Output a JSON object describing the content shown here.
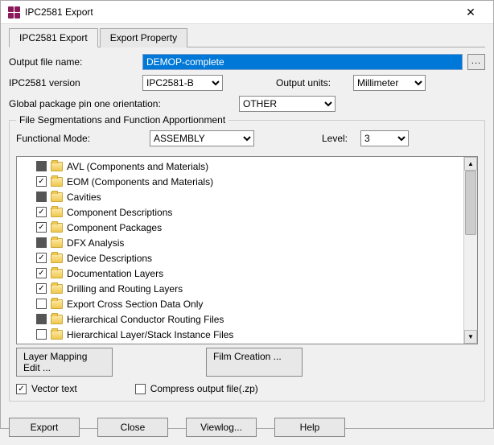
{
  "window": {
    "title": "IPC2581 Export"
  },
  "tabs": {
    "export": "IPC2581 Export",
    "property": "Export Property"
  },
  "fields": {
    "output_file_label": "Output file name:",
    "output_file_value": "DEMOP-complete",
    "version_label": "IPC2581 version",
    "version_value": "IPC2581-B",
    "output_units_label": "Output units:",
    "output_units_value": "Millimeter",
    "global_pin_label": "Global package pin one orientation:",
    "global_pin_value": "OTHER"
  },
  "group": {
    "title": "File Segmentations and Function Apportionment",
    "mode_label": "Functional Mode:",
    "mode_value": "ASSEMBLY",
    "level_label": "Level:",
    "level_value": "3"
  },
  "tree": [
    {
      "state": "filled",
      "label": "AVL (Components and Materials)"
    },
    {
      "state": "checked",
      "label": "EOM (Components and Materials)"
    },
    {
      "state": "filled",
      "label": "Cavities"
    },
    {
      "state": "checked",
      "label": "Component Descriptions"
    },
    {
      "state": "checked",
      "label": "Component Packages"
    },
    {
      "state": "filled",
      "label": "DFX Analysis"
    },
    {
      "state": "checked",
      "label": "Device Descriptions"
    },
    {
      "state": "checked",
      "label": "Documentation Layers"
    },
    {
      "state": "checked",
      "label": "Drilling and Routing Layers"
    },
    {
      "state": "empty",
      "label": "Export Cross Section Data Only"
    },
    {
      "state": "filled",
      "label": "Hierarchical Conductor Routing Files"
    },
    {
      "state": "empty",
      "label": "Hierarchical Layer/Stack Instance Files"
    }
  ],
  "buttons": {
    "layer_map": "Layer Mapping Edit ...",
    "film": "Film Creation ...",
    "vector": "Vector text",
    "compress": "Compress output file(.zp)",
    "export": "Export",
    "close": "Close",
    "viewlog": "Viewlog...",
    "help": "Help",
    "browse": "..."
  }
}
